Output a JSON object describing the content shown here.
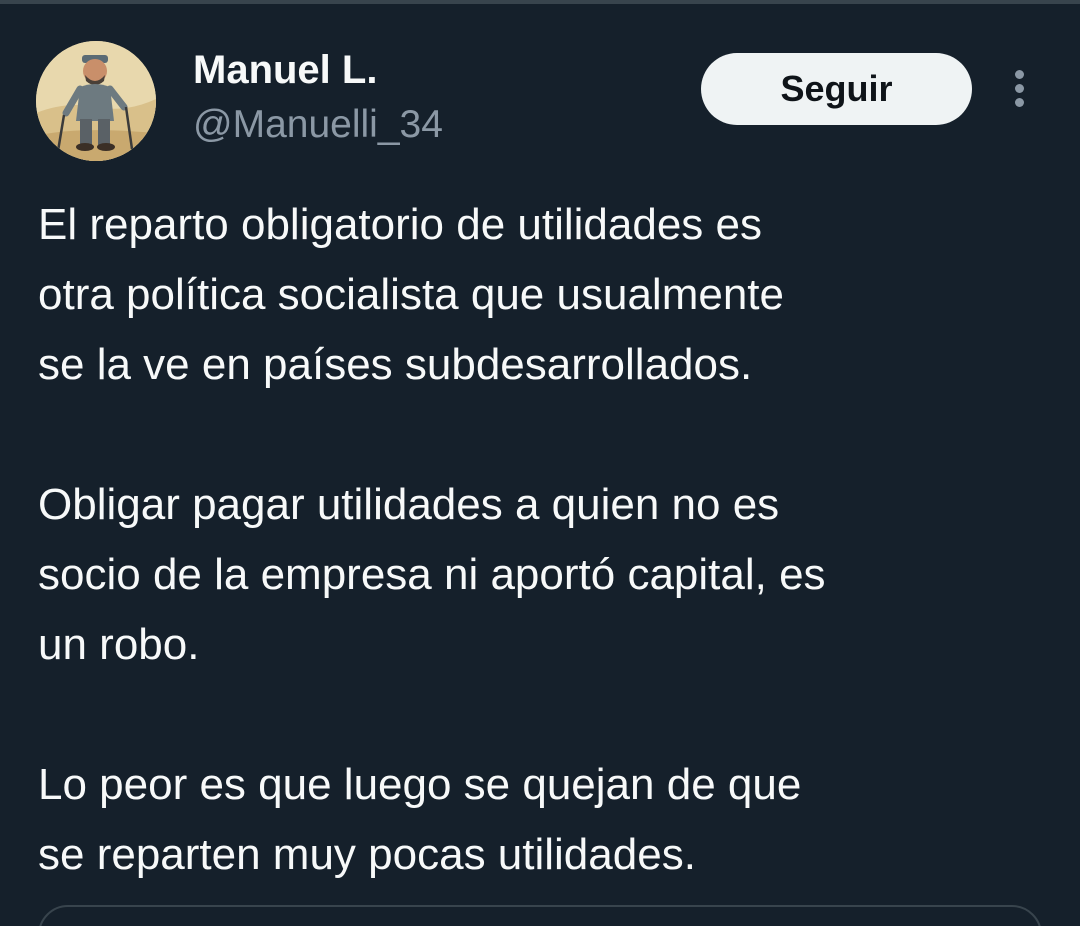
{
  "author": {
    "display_name": "Manuel L.",
    "handle": "@Manuelli_34",
    "avatar": "profile-photo-hiker-icon"
  },
  "actions": {
    "follow_label": "Seguir",
    "more_icon": "more-options-vertical-dots-icon"
  },
  "tweet": {
    "paragraphs": [
      "El reparto obligatorio de utilidades es\notra política socialista que usualmente\nse la ve en países subdesarrollados.",
      "Obligar pagar utilidades a quien no es\nsocio de la empresa ni aportó capital, es\nun robo.",
      "Lo peor es que luego se quejan de que\nse reparten muy pocas utilidades."
    ]
  },
  "colors": {
    "background": "#15202b",
    "primary_text": "#f7f9f9",
    "secondary_text": "#8b98a5",
    "button_background": "#eff3f4",
    "button_text": "#0f1419",
    "border": "#38444d"
  }
}
